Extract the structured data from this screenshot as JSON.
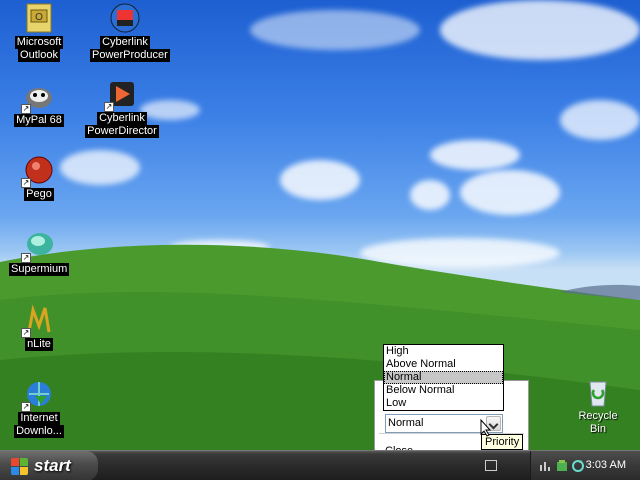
{
  "desktop": {
    "icons": [
      {
        "label_line1": "Microsoft",
        "label_line2": "Outlook",
        "icon": "outlook-icon"
      },
      {
        "label_line1": "Cyberlink",
        "label_line2": "PowerProducer",
        "icon": "powerproducer-icon"
      },
      {
        "label_line1": "MyPal 68",
        "label_line2": "",
        "icon": "mypal-icon"
      },
      {
        "label_line1": "Cyberlink",
        "label_line2": "PowerDirector",
        "icon": "powerdirector-icon"
      },
      {
        "label_line1": "Pego",
        "label_line2": "",
        "icon": "pego-icon"
      },
      {
        "label_line1": "Supermium",
        "label_line2": "",
        "icon": "supermium-icon"
      },
      {
        "label_line1": "nLite",
        "label_line2": "",
        "icon": "nlite-icon"
      },
      {
        "label_line1": "Internet",
        "label_line2": "Downlo...",
        "icon": "internet-download-icon"
      }
    ],
    "recycle_bin": {
      "label": "Recycle Bin",
      "icon": "recycle-bin-icon"
    }
  },
  "priority_menu": {
    "options": [
      "High",
      "Above Normal",
      "Normal",
      "Below Normal",
      "Low"
    ],
    "selected": "Normal",
    "combo_value": "Normal",
    "close_label": "Close",
    "tooltip": "Priority"
  },
  "taskbar": {
    "start_label": "start",
    "clock": "3:03 AM"
  },
  "colors": {
    "taskbar": "#2b2b2b",
    "sky": "#3b7fe6",
    "grass": "#3f8f2a",
    "selection": "#c7c7c7"
  }
}
